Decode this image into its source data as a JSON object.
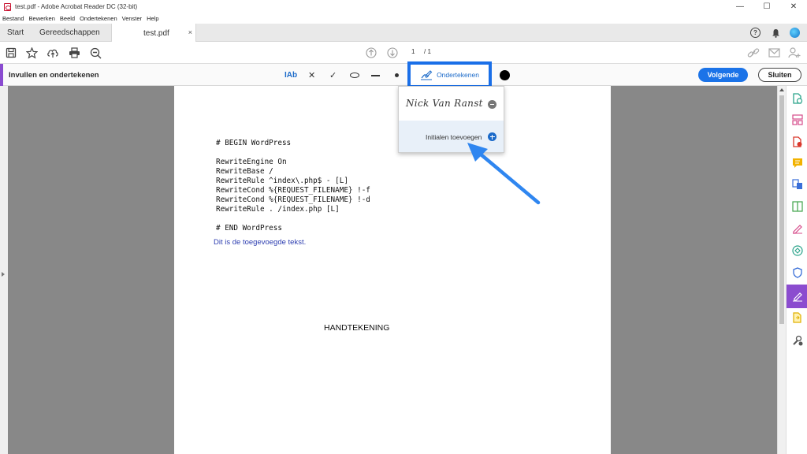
{
  "window": {
    "title": "test.pdf - Adobe Acrobat Reader DC (32-bit)",
    "minimize": "—",
    "maximize": "☐",
    "close": "✕"
  },
  "menu": [
    "Bestand",
    "Bewerken",
    "Beeld",
    "Ondertekenen",
    "Venster",
    "Help"
  ],
  "tabs": {
    "start": "Start",
    "tools": "Gereedschappen",
    "document": "test.pdf",
    "close": "×"
  },
  "toolbar": {
    "page_current": "1",
    "page_total": "/ 1"
  },
  "fill_sign": {
    "title": "Invullen en ondertekenen",
    "text_tool": "IAb",
    "cross_tool": "✕",
    "check_tool": "✓",
    "sign_button": "Ondertekenen",
    "next_button": "Volgende",
    "close_button": "Sluiten"
  },
  "document": {
    "code_lines": [
      "# BEGIN WordPress",
      "",
      "RewriteEngine On",
      "RewriteBase /",
      "RewriteRule ^index\\.php$ - [L]",
      "RewriteCond %{REQUEST_FILENAME} !-f",
      "RewriteCond %{REQUEST_FILENAME} !-d",
      "RewriteRule . /index.php [L]",
      "",
      "# END WordPress"
    ],
    "added_text": "Dit is de toegevoegde tekst.",
    "signature_label": "HANDTEKENING"
  },
  "dropdown": {
    "signature": "Nick Van Ranst",
    "initials": "Initialen toevoegen"
  },
  "colors": {
    "accent_blue": "#1b73e8",
    "highlight_blue": "#1a6fe8",
    "fill_sign_purple": "#8b4ccf",
    "added_text_blue": "#2c3db0"
  }
}
